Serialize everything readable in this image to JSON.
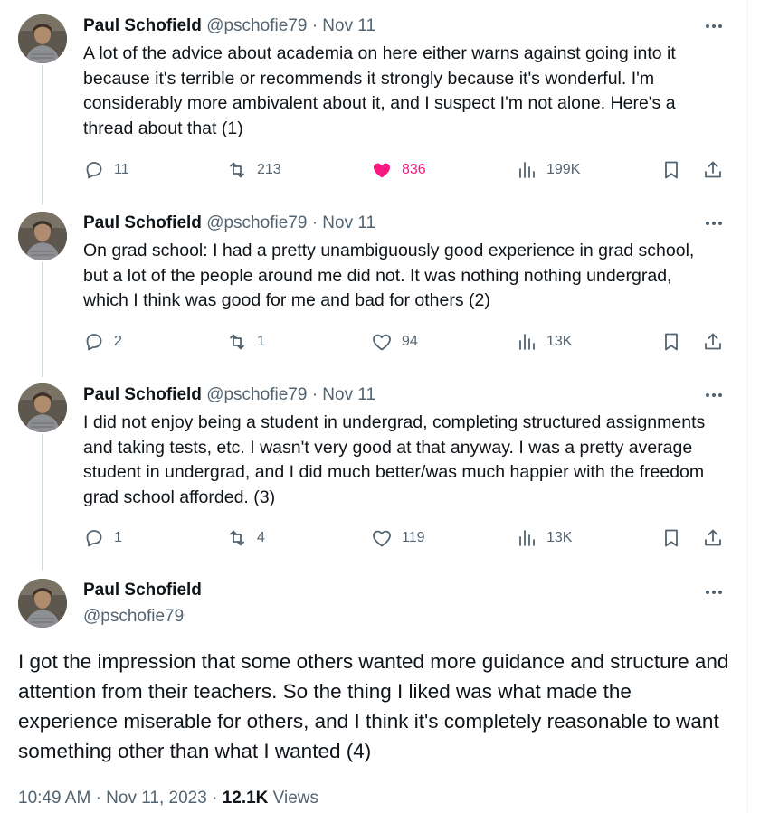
{
  "tweets": [
    {
      "name": "Paul Schofield",
      "handle": "@pschofie79",
      "separator": "·",
      "date": "Nov 11",
      "text": "A lot of the advice about academia on here either warns against going into it because it's terrible or recommends it strongly because it's wonderful. I'm considerably more ambivalent about it, and I suspect I'm not alone. Here's a thread about that (1)",
      "replies": "11",
      "retweets": "213",
      "likes": "836",
      "liked": true,
      "views": "199K"
    },
    {
      "name": "Paul Schofield",
      "handle": "@pschofie79",
      "separator": "·",
      "date": "Nov 11",
      "text": "On grad school: I had a pretty unambiguously good experience in grad school, but a lot of the people around me did not. It was nothing nothing undergrad, which I think was good for me and bad for others (2)",
      "replies": "2",
      "retweets": "1",
      "likes": "94",
      "liked": false,
      "views": "13K"
    },
    {
      "name": "Paul Schofield",
      "handle": "@pschofie79",
      "separator": "·",
      "date": "Nov 11",
      "text": "I did not enjoy being a student in undergrad, completing structured assignments and taking tests, etc. I wasn't very good at that anyway. I was a pretty average student in undergrad, and I did much better/was much happier with the freedom grad school afforded. (3)",
      "replies": "1",
      "retweets": "4",
      "likes": "119",
      "liked": false,
      "views": "13K"
    }
  ],
  "main_tweet": {
    "name": "Paul Schofield",
    "handle": "@pschofie79",
    "text": "I got the impression that some others wanted more guidance and structure and attention from their teachers. So the thing I liked was what made the experience miserable for others, and I think it's completely reasonable to want something other than what I wanted (4)",
    "time": "10:49 AM",
    "separator": "·",
    "date": "Nov 11, 2023",
    "separator2": "·",
    "views_count": "12.1K",
    "views_label": "Views"
  },
  "colors": {
    "text": "#0f1419",
    "secondary": "#536471",
    "like": "#f91880",
    "thread_line": "#cfd9de"
  }
}
